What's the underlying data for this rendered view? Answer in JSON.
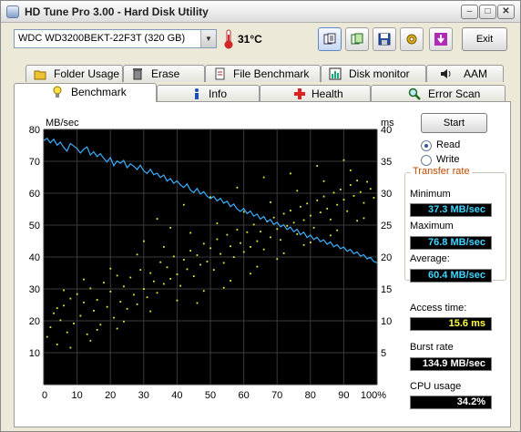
{
  "window": {
    "title": "HD Tune Pro 3.00 - Hard Disk Utility",
    "min_glyph": "–",
    "max_glyph": "□",
    "close_glyph": "✕"
  },
  "toolbar": {
    "drive": "WDC WD3200BEKT-22F3T (320 GB)",
    "drive_arrow_glyph": "▼",
    "temperature": "31°C",
    "exit_label": "Exit",
    "icons": [
      "copy-info-icon",
      "copy-icon",
      "save-icon",
      "options-icon",
      "help-icon"
    ]
  },
  "tabs": {
    "row1": [
      {
        "label": "Folder Usage",
        "icon": "folder-icon"
      },
      {
        "label": "Erase",
        "icon": "trash-icon"
      },
      {
        "label": "File Benchmark",
        "icon": "file-icon"
      },
      {
        "label": "Disk monitor",
        "icon": "monitor-chart-icon"
      },
      {
        "label": "AAM",
        "icon": "speaker-icon"
      }
    ],
    "row2": [
      {
        "label": "Benchmark",
        "icon": "lightbulb-icon",
        "active": true
      },
      {
        "label": "Info",
        "icon": "info-icon"
      },
      {
        "label": "Health",
        "icon": "health-cross-icon"
      },
      {
        "label": "Error Scan",
        "icon": "magnifier-icon"
      }
    ]
  },
  "controls": {
    "start_label": "Start",
    "read_label": "Read",
    "write_label": "Write",
    "selected_mode": "Read"
  },
  "stats": {
    "transfer_rate_legend": "Transfer rate",
    "minimum_label": "Minimum",
    "minimum_value": "37.3 MB/sec",
    "maximum_label": "Maximum",
    "maximum_value": "76.8 MB/sec",
    "average_label": "Average:",
    "average_value": "60.4 MB/sec",
    "access_time_label": "Access time:",
    "access_time_value": "15.6 ms",
    "burst_rate_label": "Burst rate",
    "burst_rate_value": "134.9 MB/sec",
    "cpu_usage_label": "CPU usage",
    "cpu_usage_value": "34.2%"
  },
  "colors": {
    "transfer_line": "#3ab0ff",
    "access_dots": "#e8e83a",
    "graph_bg": "#000000",
    "grid": "#3a3a3a",
    "min_value": "#3fd6ff",
    "access_value": "#ffff40"
  },
  "chart_data": {
    "type": "line",
    "ylabel": "MB/sec",
    "y2label": "ms",
    "xlim": [
      0,
      100
    ],
    "ylim": [
      0,
      80
    ],
    "y2lim": [
      0,
      40
    ],
    "x_ticks": [
      "0",
      "10",
      "20",
      "30",
      "40",
      "50",
      "60",
      "70",
      "80",
      "90",
      "100%"
    ],
    "y_ticks": [
      "80",
      "70",
      "60",
      "50",
      "40",
      "30",
      "20",
      "10"
    ],
    "y2_ticks": [
      "40",
      "35",
      "30",
      "25",
      "20",
      "15",
      "10",
      "5"
    ],
    "grid": true,
    "series": [
      {
        "kind": "transfer_rate",
        "x": [
          0,
          1,
          2,
          3,
          4,
          5,
          6,
          7,
          8,
          9,
          10,
          11,
          12,
          13,
          14,
          15,
          16,
          17,
          18,
          19,
          20,
          21,
          22,
          23,
          24,
          25,
          26,
          27,
          28,
          29,
          30,
          31,
          32,
          33,
          34,
          35,
          36,
          37,
          38,
          39,
          40,
          41,
          42,
          43,
          44,
          45,
          46,
          47,
          48,
          49,
          50,
          51,
          52,
          53,
          54,
          55,
          56,
          57,
          58,
          59,
          60,
          61,
          62,
          63,
          64,
          65,
          66,
          67,
          68,
          69,
          70,
          71,
          72,
          73,
          74,
          75,
          76,
          77,
          78,
          79,
          80,
          81,
          82,
          83,
          84,
          85,
          86,
          87,
          88,
          89,
          90,
          91,
          92,
          93,
          94,
          95,
          96,
          97,
          98,
          99,
          100
        ],
        "values": [
          76.5,
          77.2,
          75.8,
          76.9,
          75.1,
          76.0,
          74.3,
          73.2,
          75.6,
          74.8,
          74.0,
          72.6,
          73.8,
          74.5,
          72.0,
          73.0,
          71.5,
          72.4,
          70.9,
          69.8,
          71.2,
          68.6,
          70.1,
          69.4,
          70.3,
          68.0,
          69.2,
          68.5,
          67.4,
          68.8,
          67.0,
          66.2,
          67.5,
          65.8,
          66.3,
          64.9,
          65.7,
          63.8,
          64.6,
          63.1,
          63.9,
          62.6,
          61.8,
          62.9,
          61.0,
          60.2,
          61.5,
          59.7,
          60.5,
          59.1,
          58.3,
          59.0,
          57.6,
          58.4,
          56.9,
          57.5,
          55.8,
          56.6,
          55.1,
          54.3,
          55.2,
          53.6,
          54.4,
          52.8,
          53.5,
          51.9,
          52.7,
          51.0,
          51.8,
          50.2,
          50.9,
          49.5,
          50.1,
          48.6,
          49.4,
          47.9,
          48.7,
          47.0,
          47.8,
          46.1,
          46.9,
          45.5,
          46.2,
          44.8,
          45.4,
          44.0,
          44.7,
          43.2,
          43.9,
          42.6,
          43.1,
          41.8,
          42.4,
          41.0,
          41.6,
          40.3,
          40.7,
          39.4,
          39.9,
          38.6,
          38.2
        ]
      }
    ],
    "access_times_ms": [
      [
        1,
        7.5
      ],
      [
        2,
        9.0
      ],
      [
        3,
        11.2
      ],
      [
        4,
        6.3
      ],
      [
        5,
        10.1
      ],
      [
        6,
        12.4
      ],
      [
        7,
        8.2
      ],
      [
        8,
        13.5
      ],
      [
        9,
        9.6
      ],
      [
        10,
        14.2
      ],
      [
        11,
        10.8
      ],
      [
        12,
        12.9
      ],
      [
        13,
        7.9
      ],
      [
        14,
        15.1
      ],
      [
        15,
        11.6
      ],
      [
        16,
        13.3
      ],
      [
        17,
        9.4
      ],
      [
        18,
        16.0
      ],
      [
        19,
        12.2
      ],
      [
        20,
        14.6
      ],
      [
        21,
        10.5
      ],
      [
        22,
        17.1
      ],
      [
        23,
        13.0
      ],
      [
        24,
        15.4
      ],
      [
        25,
        11.9
      ],
      [
        26,
        16.8
      ],
      [
        27,
        14.1
      ],
      [
        28,
        12.6
      ],
      [
        29,
        18.0
      ],
      [
        30,
        15.0
      ],
      [
        31,
        13.7
      ],
      [
        32,
        17.5
      ],
      [
        33,
        16.2
      ],
      [
        34,
        14.4
      ],
      [
        35,
        19.2
      ],
      [
        36,
        15.8
      ],
      [
        37,
        18.4
      ],
      [
        38,
        16.6
      ],
      [
        39,
        20.1
      ],
      [
        40,
        17.3
      ],
      [
        41,
        15.5
      ],
      [
        42,
        19.6
      ],
      [
        43,
        18.1
      ],
      [
        44,
        21.0
      ],
      [
        45,
        17.0
      ],
      [
        46,
        20.3
      ],
      [
        47,
        18.8
      ],
      [
        48,
        22.1
      ],
      [
        49,
        19.3
      ],
      [
        50,
        21.4
      ],
      [
        51,
        18.0
      ],
      [
        52,
        22.8
      ],
      [
        53,
        20.5
      ],
      [
        54,
        19.1
      ],
      [
        55,
        23.5
      ],
      [
        56,
        21.7
      ],
      [
        57,
        20.0
      ],
      [
        58,
        24.3
      ],
      [
        59,
        22.2
      ],
      [
        60,
        20.8
      ],
      [
        61,
        23.9
      ],
      [
        62,
        21.6
      ],
      [
        63,
        25.1
      ],
      [
        64,
        22.5
      ],
      [
        65,
        24.0
      ],
      [
        66,
        21.2
      ],
      [
        67,
        25.6
      ],
      [
        68,
        23.1
      ],
      [
        69,
        26.2
      ],
      [
        70,
        24.4
      ],
      [
        71,
        22.7
      ],
      [
        72,
        26.8
      ],
      [
        73,
        24.9
      ],
      [
        74,
        27.3
      ],
      [
        75,
        25.4
      ],
      [
        76,
        23.6
      ],
      [
        77,
        27.9
      ],
      [
        78,
        25.8
      ],
      [
        79,
        28.4
      ],
      [
        80,
        26.5
      ],
      [
        81,
        24.6
      ],
      [
        82,
        28.9
      ],
      [
        83,
        27.0
      ],
      [
        84,
        29.5
      ],
      [
        85,
        27.6
      ],
      [
        86,
        25.9
      ],
      [
        87,
        30.1
      ],
      [
        88,
        28.2
      ],
      [
        89,
        30.6
      ],
      [
        90,
        29.0
      ],
      [
        91,
        27.2
      ],
      [
        92,
        31.3
      ],
      [
        93,
        29.6
      ],
      [
        94,
        32.0
      ],
      [
        95,
        30.2
      ],
      [
        96,
        28.5
      ],
      [
        97,
        31.8
      ],
      [
        98,
        30.7
      ],
      [
        99,
        29.3
      ],
      [
        4,
        12.0
      ],
      [
        8,
        5.8
      ],
      [
        12,
        16.5
      ],
      [
        16,
        8.6
      ],
      [
        20,
        18.2
      ],
      [
        24,
        9.9
      ],
      [
        28,
        20.4
      ],
      [
        32,
        11.5
      ],
      [
        36,
        21.6
      ],
      [
        40,
        13.2
      ],
      [
        44,
        23.8
      ],
      [
        48,
        14.7
      ],
      [
        52,
        25.3
      ],
      [
        56,
        16.3
      ],
      [
        60,
        27.1
      ],
      [
        64,
        18.5
      ],
      [
        68,
        28.6
      ],
      [
        72,
        20.6
      ],
      [
        76,
        30.4
      ],
      [
        80,
        22.3
      ],
      [
        84,
        31.9
      ],
      [
        88,
        24.2
      ],
      [
        92,
        33.6
      ],
      [
        96,
        26.1
      ],
      [
        6,
        14.8
      ],
      [
        14,
        6.9
      ],
      [
        22,
        8.8
      ],
      [
        30,
        22.5
      ],
      [
        38,
        24.6
      ],
      [
        46,
        12.8
      ],
      [
        54,
        15.2
      ],
      [
        62,
        17.4
      ],
      [
        70,
        19.7
      ],
      [
        78,
        21.9
      ],
      [
        86,
        23.4
      ],
      [
        94,
        25.7
      ],
      [
        34,
        26.0
      ],
      [
        42,
        28.2
      ],
      [
        50,
        29.4
      ],
      [
        58,
        30.9
      ],
      [
        66,
        32.5
      ],
      [
        74,
        33.1
      ],
      [
        82,
        34.3
      ],
      [
        90,
        35.2
      ]
    ]
  }
}
